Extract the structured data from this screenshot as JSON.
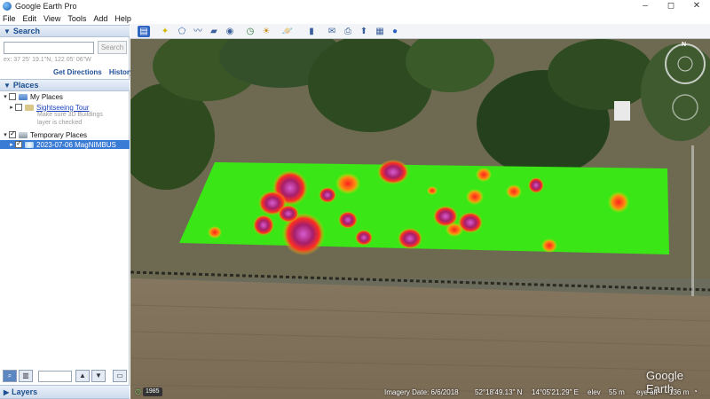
{
  "window": {
    "title": "Google Earth Pro",
    "min_label": "–",
    "max_label": "◻",
    "close_label": "✕"
  },
  "menu": {
    "items": [
      "File",
      "Edit",
      "View",
      "Tools",
      "Add",
      "Help"
    ]
  },
  "search": {
    "header": "Search",
    "input_value": "",
    "button_label": "Search",
    "hint": "ex: 37 25' 19.1\"N, 122 05' 06\"W",
    "get_directions": "Get Directions",
    "history": "History"
  },
  "places": {
    "header": "Places",
    "my_places": "My Places",
    "sightseeing_tour": "Sightseeing Tour",
    "note_line1": "Make sure 3D Buildings",
    "note_line2": "layer is checked",
    "temporary_places": "Temporary Places",
    "overlay_item": "2023-07-06 MagNIMBUS"
  },
  "layers": {
    "header": "Layers"
  },
  "map": {
    "compass_letter": "N",
    "watermark": "Google Earth",
    "year_badge": "1985",
    "imagery_date": "Imagery Date: 6/6/2018",
    "lat": "52°18'49.13\" N",
    "lon": "14°05'21.29\" E",
    "elev_label": "elev",
    "elev_value": "55 m",
    "eye_alt_label": "eye alt",
    "eye_alt_value": "136 m",
    "colors": {
      "heatmap_base": "#33ee11",
      "heatmap_high": "#c02070",
      "heatmap_mid": "#ff3a20",
      "field": "#8a7a64"
    }
  },
  "toolbar": {
    "icons": [
      "sidebar-icon",
      "placemark-icon",
      "polygon-icon",
      "path-icon",
      "image-overlay-icon",
      "tour-icon",
      "historical-imagery-icon",
      "sunlight-icon",
      "planets-icon",
      "ruler-icon",
      "email-icon",
      "print-icon",
      "save-image-icon",
      "view-in-maps-icon",
      "earth-icon"
    ]
  }
}
